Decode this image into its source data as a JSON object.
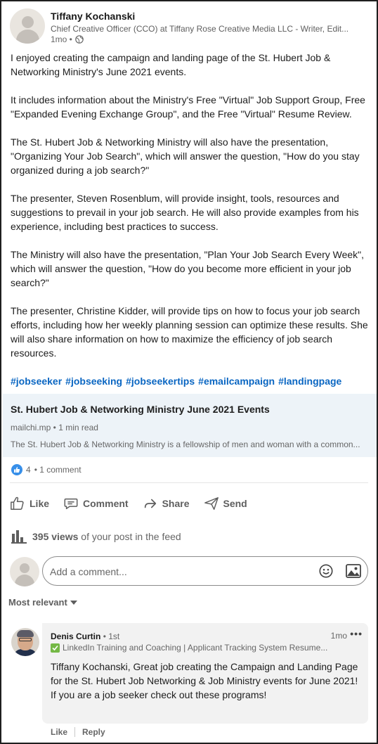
{
  "post": {
    "author": {
      "name": "Tiffany Kochanski",
      "headline": "Chief Creative Officer (CCO) at Tiffany Rose Creative Media LLC - Writer, Edit...",
      "time": "1mo •",
      "visibility_icon": "globe-icon"
    },
    "paragraphs": [
      "I enjoyed creating the campaign and landing page of the St. Hubert Job & Networking Ministry's June 2021 events.",
      "It includes information about the Ministry's Free \"Virtual\" Job Support Group, Free \"Expanded Evening Exchange Group\", and the Free \"Virtual\" Resume Review.",
      "The St. Hubert Job & Networking Ministry will also have the presentation, \"Organizing Your Job Search\", which will answer the question, \"How do you stay organized during a job search?\"",
      "The presenter, Steven Rosenblum, will provide insight, tools, resources and suggestions to prevail in your job search. He will also provide examples from his experience, including best practices to success.",
      "The Ministry will also have the presentation, \"Plan Your Job Search Every Week\", which will answer the question, \"How do you become more efficient in your job search?\"",
      "The presenter, Christine Kidder, will provide tips on how to focus your job search efforts, including how her weekly planning session can optimize these results. She will also share information on how to maximize the efficiency of job search resources."
    ],
    "hashtags": [
      "#jobseeker",
      "#jobseeking",
      "#jobseekertips",
      "#emailcampaign",
      "#landingpage"
    ]
  },
  "link_preview": {
    "title": "St. Hubert Job & Networking Ministry June 2021 Events",
    "source": "mailchi.mp • 1 min read",
    "description": "The St. Hubert Job & Networking Ministry is a fellowship of men and woman with a common..."
  },
  "reactions": {
    "count": "4",
    "comments": "• 1 comment"
  },
  "actions": {
    "like": "Like",
    "comment": "Comment",
    "share": "Share",
    "send": "Send"
  },
  "views": {
    "count": "395 views",
    "suffix": "of your post in the feed"
  },
  "comment_input": {
    "placeholder": "Add a comment..."
  },
  "sort": {
    "label": "Most relevant"
  },
  "comments": [
    {
      "name": "Denis Curtin",
      "degree": "• 1st",
      "headline": "LinkedIn Training and Coaching | Applicant Tracking System Resume...",
      "time": "1mo",
      "more": "•••",
      "text_lines": [
        "Tiffany Kochanski, Great job creating the Campaign and Landing Page for the St. Hubert Job Networking & Job Ministry events for June 2021!",
        "If you are a job seeker check out these programs!"
      ],
      "like_label": "Like",
      "reply_label": "Reply"
    }
  ],
  "colors": {
    "link": "#0a66c2",
    "preview_bg": "#edf3f8",
    "like_blue": "#378fe9",
    "comment_bg": "#f2f2f2"
  }
}
